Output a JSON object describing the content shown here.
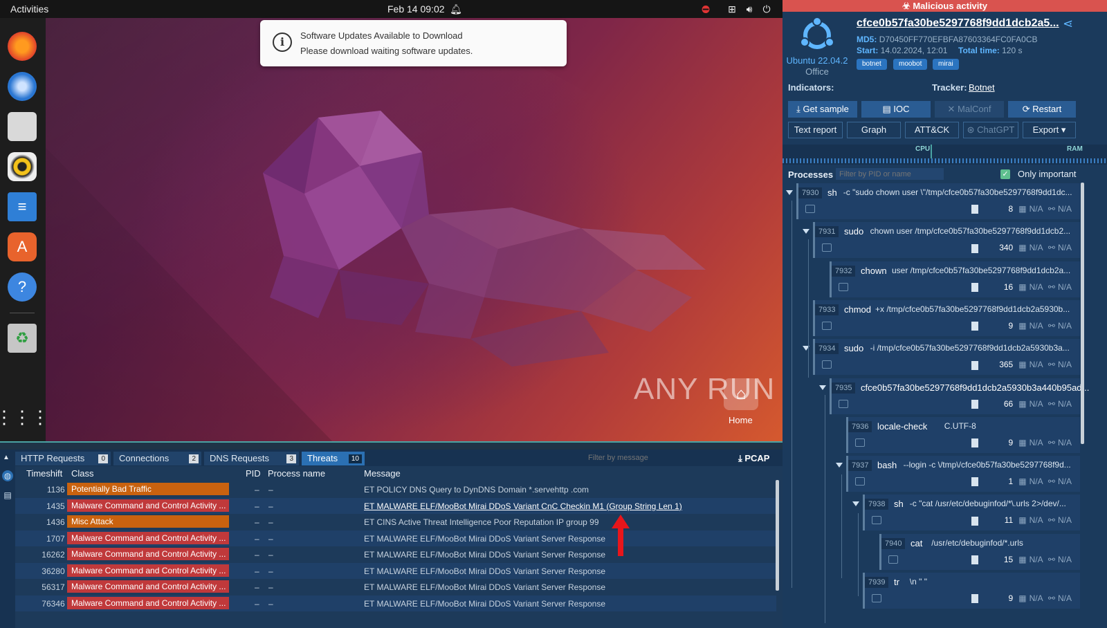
{
  "topbar": {
    "activities": "Activities",
    "clock": "Feb 14  09:02"
  },
  "notification": {
    "title": "Software Updates Available to Download",
    "body": "Please download waiting software updates."
  },
  "desktop": {
    "watermark": "ANY RUN",
    "home_label": "Home"
  },
  "dock": {
    "icons": [
      "firefox-icon",
      "thunderbird-icon",
      "files-icon",
      "rhythmbox-icon",
      "writer-icon",
      "software-center-icon",
      "help-icon",
      "trash-icon",
      "app-grid-icon"
    ]
  },
  "bottom": {
    "tabs": [
      {
        "label": "HTTP Requests",
        "count": "0"
      },
      {
        "label": "Connections",
        "count": "2"
      },
      {
        "label": "DNS Requests",
        "count": "3"
      },
      {
        "label": "Threats",
        "count": "10"
      }
    ],
    "filter_placeholder": "Filter by message",
    "pcap": "PCAP",
    "columns": {
      "timeshift": "Timeshift",
      "class": "Class",
      "pid": "PID",
      "process": "Process name",
      "message": "Message"
    },
    "rows": [
      {
        "ts": "1136 ms",
        "cls": "Potentially Bad Traffic",
        "pid": "–",
        "pn": "–",
        "msg": "ET POLICY DNS Query to DynDNS Domain *.servehttp .com",
        "color": "#c9620f"
      },
      {
        "ts": "1435 ms",
        "cls": "Malware Command and Control Activity ...",
        "pid": "–",
        "pn": "–",
        "msg": "ET MALWARE ELF/MooBot Mirai DDoS Variant CnC Checkin M1 (Group String Len 1)",
        "color": "#c0393b"
      },
      {
        "ts": "1436 ms",
        "cls": "Misc Attack",
        "pid": "–",
        "pn": "–",
        "msg": "ET CINS Active Threat Intelligence Poor Reputation IP group 99",
        "color": "#c9620f"
      },
      {
        "ts": "1707 ms",
        "cls": "Malware Command and Control Activity ...",
        "pid": "–",
        "pn": "–",
        "msg": "ET MALWARE ELF/MooBot Mirai DDoS Variant Server Response",
        "color": "#c0393b"
      },
      {
        "ts": "16262 ms",
        "cls": "Malware Command and Control Activity ...",
        "pid": "–",
        "pn": "–",
        "msg": "ET MALWARE ELF/MooBot Mirai DDoS Variant Server Response",
        "color": "#c0393b"
      },
      {
        "ts": "36280 ms",
        "cls": "Malware Command and Control Activity ...",
        "pid": "–",
        "pn": "–",
        "msg": "ET MALWARE ELF/MooBot Mirai DDoS Variant Server Response",
        "color": "#c0393b"
      },
      {
        "ts": "56317 ms",
        "cls": "Malware Command and Control Activity ...",
        "pid": "–",
        "pn": "–",
        "msg": "ET MALWARE ELF/MooBot Mirai DDoS Variant Server Response",
        "color": "#c0393b"
      },
      {
        "ts": "76346 ms",
        "cls": "Malware Command and Control Activity ...",
        "pid": "–",
        "pn": "–",
        "msg": "ET MALWARE ELF/MooBot Mirai DDoS Variant Server Response",
        "color": "#c0393b"
      }
    ]
  },
  "report": {
    "banner": "Malicious activity",
    "hash": "cfce0b57fa30be5297768f9dd1dcb2a5...",
    "md5_label": "MD5:",
    "md5": "D70450FF770EFBFA87603364FC0FA0CB",
    "start_label": "Start:",
    "start": "14.02.2024, 12:01",
    "total_label": "Total time:",
    "total": "120 s",
    "os": "Ubuntu 22.04.2",
    "os_sub": "Office",
    "tags": [
      "botnet",
      "moobot",
      "mirai"
    ],
    "indicators": "Indicators:",
    "tracker": "Tracker:",
    "tracker_value": "Botnet",
    "buttons1": [
      "Get sample",
      "IOC",
      "MalConf",
      "Restart"
    ],
    "buttons2": [
      "Text report",
      "Graph",
      "ATT&CK",
      "ChatGPT",
      "Export"
    ],
    "cpu": "CPU",
    "ram": "RAM",
    "processes_label": "Processes",
    "proc_filter": "Filter by PID or name",
    "only_important": "Only important",
    "processes": [
      {
        "pid": "7930",
        "name": "sh",
        "args": "-c \"sudo chown user \\\"/tmp/cfce0b57fa30be5297768f9dd1dc...",
        "count": "8"
      },
      {
        "pid": "7931",
        "name": "sudo",
        "args": "chown user /tmp/cfce0b57fa30be5297768f9dd1dcb2...",
        "count": "340"
      },
      {
        "pid": "7932",
        "name": "chown",
        "args": "user /tmp/cfce0b57fa30be5297768f9dd1dcb2a...",
        "count": "16"
      },
      {
        "pid": "7933",
        "name": "chmod",
        "args": "+x /tmp/cfce0b57fa30be5297768f9dd1dcb2a5930b...",
        "count": "9"
      },
      {
        "pid": "7934",
        "name": "sudo",
        "args": "-i /tmp/cfce0b57fa30be5297768f9dd1dcb2a5930b3a...",
        "count": "365"
      },
      {
        "pid": "7935",
        "name": "cfce0b57fa30be5297768f9dd1dcb2a5930b3a440b95ad...",
        "args": "",
        "count": "66"
      },
      {
        "pid": "7936",
        "name": "locale-check",
        "args": "C.UTF-8",
        "count": "9"
      },
      {
        "pid": "7937",
        "name": "bash",
        "args": "--login -c \\/tmp\\/cfce0b57fa30be5297768f9d...",
        "count": "1"
      },
      {
        "pid": "7938",
        "name": "sh",
        "args": "-c \"cat /usr/etc/debuginfod/*\\.urls 2>/dev/...",
        "count": "11"
      },
      {
        "pid": "7940",
        "name": "cat",
        "args": "/usr/etc/debuginfod/*.urls",
        "count": "15"
      },
      {
        "pid": "7939",
        "name": "tr",
        "args": "\\n \" \"",
        "count": "9"
      }
    ],
    "na": "N/A"
  }
}
